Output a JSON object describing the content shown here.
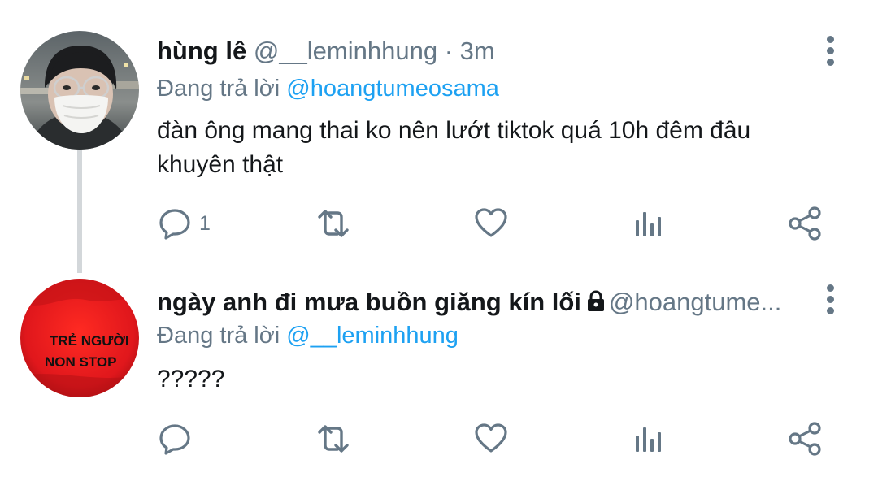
{
  "tweets": [
    {
      "name": "hùng lê",
      "handle": "@__leminhhung",
      "separator": "·",
      "time": "3m",
      "replying_prefix": "Đang trả lời",
      "replying_to": "@hoangtumeosama",
      "text": "đàn ông mang thai ko nên lướt tiktok quá 10h đêm đâu khuyên thật",
      "reply_count": "1",
      "avatar_icon": "masked-man-with-glasses-avatar"
    },
    {
      "name": "ngày anh đi mưa buồn giăng kín lối",
      "handle": "@hoangtume...",
      "protected_icon": "lock-icon",
      "replying_prefix": "Đang trả lời",
      "replying_to": "@__leminhhung",
      "text": "?????",
      "reply_count": "",
      "avatar_icon": "red-shirt-avatar",
      "avatar_text": [
        "TRẺ NGƯỜI",
        "NON STOP"
      ]
    }
  ],
  "colors": {
    "text": "#14171a",
    "secondary": "#657786",
    "mention": "#1da1f2",
    "thread_line": "#d3d7da",
    "avatar2_red": "#e0171c"
  }
}
